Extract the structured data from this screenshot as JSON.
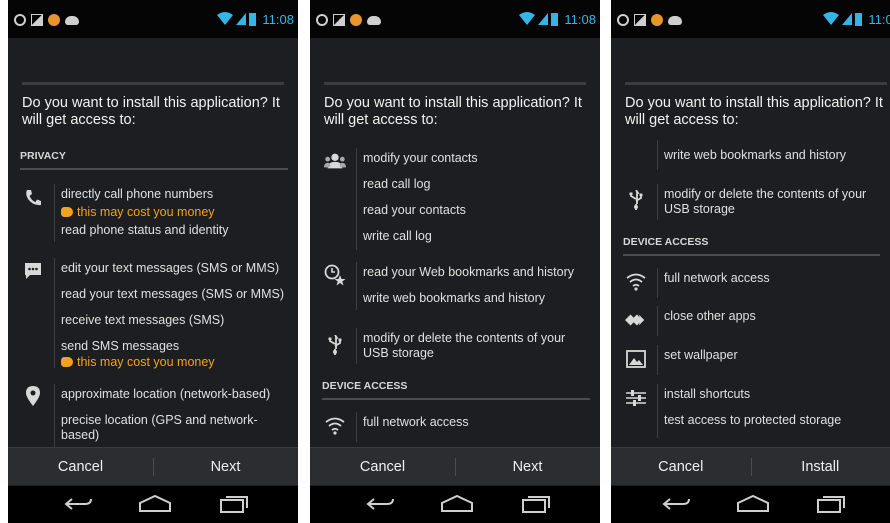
{
  "screens": [
    {
      "status": {
        "time": "11:08"
      },
      "question": "Do you want to install this application? It will get access to:",
      "section_privacy": "PRIVACY",
      "perm_call": {
        "icon": "phone-icon",
        "lines": [
          "directly call phone numbers"
        ],
        "warning": "this may cost you money",
        "extra": "read phone status and identity"
      },
      "perm_sms": {
        "icon": "message-icon",
        "lines": [
          "edit your text messages (SMS or MMS)",
          "read your text messages (SMS or MMS)",
          "receive text messages (SMS)",
          "send SMS messages"
        ],
        "warning": "this may cost you money"
      },
      "perm_location": {
        "icon": "location-pin-icon",
        "lines": [
          "approximate location (network-based)",
          "precise location (GPS and network-based)"
        ]
      },
      "buttons": {
        "cancel": "Cancel",
        "next": "Next"
      }
    },
    {
      "status": {
        "time": "11:08"
      },
      "question": "Do you want to install this application? It will get access to:",
      "perm_contacts": {
        "icon": "contacts-icon",
        "lines": [
          "modify your contacts",
          "read call log",
          "read your contacts",
          "write call log"
        ]
      },
      "perm_bookmarks": {
        "icon": "bookmark-star-icon",
        "lines": [
          "read your Web bookmarks and history",
          "write web bookmarks and history"
        ]
      },
      "perm_usb": {
        "icon": "usb-icon",
        "lines": [
          "modify or delete the contents of your USB storage"
        ]
      },
      "section_device": "DEVICE ACCESS",
      "perm_network": {
        "icon": "wifi-icon",
        "lines": [
          "full network access"
        ]
      },
      "buttons": {
        "cancel": "Cancel",
        "next": "Next"
      }
    },
    {
      "status": {
        "time": "11:08"
      },
      "question": "Do you want to install this application? It will get access to:",
      "perm_bookmarks_cont": {
        "lines": [
          "write web bookmarks and history"
        ]
      },
      "perm_usb": {
        "icon": "usb-icon",
        "lines": [
          "modify or delete the contents of your USB storage"
        ]
      },
      "section_device": "DEVICE ACCESS",
      "perm_network": {
        "icon": "wifi-icon",
        "lines": [
          "full network access"
        ]
      },
      "perm_apps": {
        "icon": "close-apps-icon",
        "lines": [
          "close other apps"
        ]
      },
      "perm_wallpaper": {
        "icon": "wallpaper-icon",
        "lines": [
          "set wallpaper"
        ]
      },
      "perm_shortcuts": {
        "icon": "sliders-icon",
        "lines": [
          "install shortcuts",
          "test access to protected storage"
        ]
      },
      "buttons": {
        "cancel": "Cancel",
        "install": "Install"
      }
    }
  ],
  "colors": {
    "background": "#1d1e21",
    "accent": "#33b5e5",
    "warning": "#f0a41c",
    "statusbar": "#050505"
  }
}
